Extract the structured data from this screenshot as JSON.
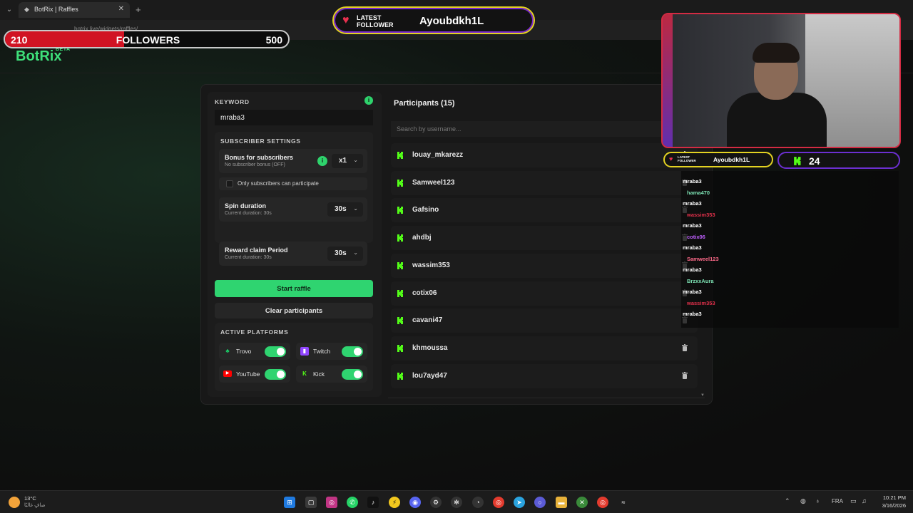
{
  "browser": {
    "tab_title": "BotRix | Raffles",
    "tab_close": "✕",
    "new_tab": "+",
    "url": "botrix.live/widgets/raffles/"
  },
  "site": {
    "logo": "BotRix",
    "logo_badge": "BETA"
  },
  "followers_goal": {
    "current": "210",
    "label": "FOLLOWERS",
    "target": "500",
    "progress_fraction": 0.42,
    "fill_color": "#d11323"
  },
  "latest_follower": {
    "label_line1": "LATEST",
    "label_line2": "FOLLOWER",
    "name": "Ayoubdkh1L",
    "border_color": "#e3d222"
  },
  "raffle": {
    "keyword_label": "KEYWORD",
    "keyword_value": "mraba3",
    "subscriber_settings_label": "SUBSCRIBER SETTINGS",
    "bonus_title": "Bonus for subscribers",
    "bonus_subtitle": "No subscriber bonus (OFF)",
    "bonus_value": "x1",
    "only_subs_label": "Only subscribers can participate",
    "spin_title": "Spin duration",
    "spin_subtitle": "Current duration: 30s",
    "spin_value": "30s",
    "reward_title": "Reward claim Period",
    "reward_subtitle": "Current duration: 30s",
    "reward_value": "30s",
    "start_button": "Start raffle",
    "clear_button": "Clear participants",
    "platforms_label": "ACTIVE PLATFORMS",
    "platforms": [
      {
        "name": "Trovo",
        "icon": "trovo-icon",
        "enabled": true,
        "color": "#19d66b"
      },
      {
        "name": "Twitch",
        "icon": "twitch-icon",
        "enabled": true,
        "color": "#9146ff"
      },
      {
        "name": "YouTube",
        "icon": "youtube-icon",
        "enabled": true,
        "color": "#ff0000"
      },
      {
        "name": "Kick",
        "icon": "kick-icon",
        "enabled": true,
        "color": "#53fc18"
      }
    ],
    "accent_color": "#2fd470"
  },
  "participants": {
    "header": "Participants (15)",
    "search_placeholder": "Search by username...",
    "items": [
      "louay_mkarezz",
      "Samweel123",
      "Gafsino",
      "ahdbj",
      "wassim353",
      "cotix06",
      "cavani47",
      "khmoussa",
      "lou7ayd47"
    ]
  },
  "mini_latest_follower": {
    "label_line1": "LATEST",
    "label_line2": "FOLLOWER",
    "name": "Ayoubdkh1L"
  },
  "kick_followers": {
    "count": "24"
  },
  "chat": [
    {
      "text": "mraba3",
      "color": "#ffffff",
      "type": "message"
    },
    {
      "text": "hama470",
      "color": "#7de3b4",
      "type": "user"
    },
    {
      "text": "mraba3",
      "color": "#ffffff",
      "type": "message"
    },
    {
      "text": "wassim353",
      "color": "#e0304a",
      "type": "user"
    },
    {
      "text": "mraba3",
      "color": "#ffffff",
      "type": "message"
    },
    {
      "text": "cotix06",
      "color": "#c060ff",
      "type": "user"
    },
    {
      "text": "mraba3",
      "color": "#ffffff",
      "type": "message"
    },
    {
      "text": "Samweel123",
      "color": "#ff6a8a",
      "type": "user"
    },
    {
      "text": "mraba3",
      "color": "#ffffff",
      "type": "message"
    },
    {
      "text": "BrzxxAura",
      "color": "#7de3b4",
      "type": "user"
    },
    {
      "text": "mraba3",
      "color": "#ffffff",
      "type": "message"
    },
    {
      "text": "wassim353",
      "color": "#e0304a",
      "type": "user"
    },
    {
      "text": "mraba3",
      "color": "#ffffff",
      "type": "message"
    }
  ],
  "taskbar": {
    "weather_temp": "13°C",
    "weather_desc": "صافٍ غالبًا",
    "language": "FRA",
    "time": "10:21 PM",
    "date": "3/16/2026"
  }
}
